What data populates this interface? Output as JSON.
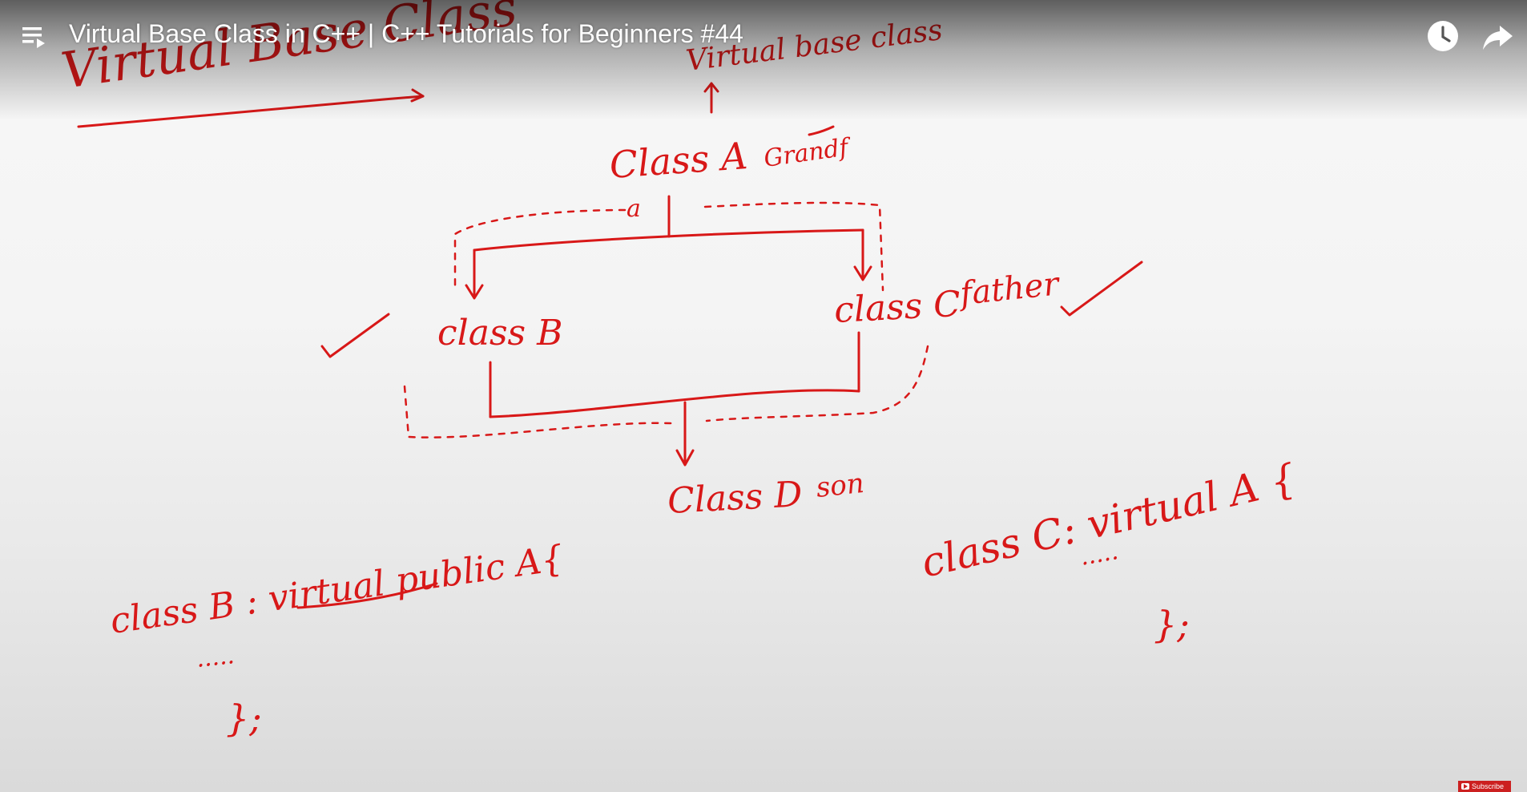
{
  "player": {
    "title": "Virtual Base Class in C++ | C++ Tutorials for Beginners #44",
    "subscribe_label": "Subscribe"
  },
  "board": {
    "heading": "Virtual Base Class",
    "note_virtual_base": "Virtual base class",
    "class_a": "Class A",
    "class_a_role": "Grandf",
    "member_a": "a",
    "class_b": "class B",
    "class_c": "class C",
    "class_c_role": "father",
    "class_d": "Class D",
    "class_d_role": "son",
    "code_b": "class B : virtual public A{",
    "code_b_dots": ".....",
    "code_b_end": "};",
    "code_c": "class C: virtual A {",
    "code_c_dots": ".....",
    "code_c_end": "};"
  },
  "colors": {
    "ink": "#d81818",
    "overlay_text": "#ffffff"
  },
  "icons": [
    "playlist-icon",
    "clock-icon",
    "share-icon",
    "checkmark-icon",
    "arrow-icon"
  ]
}
